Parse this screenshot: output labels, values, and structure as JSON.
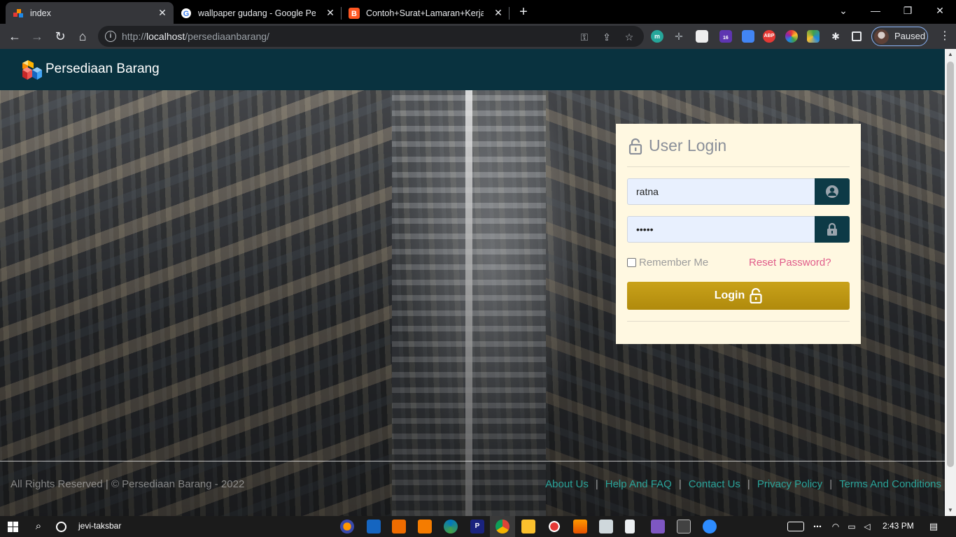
{
  "browser": {
    "tabs": [
      {
        "title": "index",
        "active": true
      },
      {
        "title": "wallpaper gudang - Google Pene",
        "active": false
      },
      {
        "title": "Contoh+Surat+Lamaran+Kerja+",
        "active": false
      }
    ],
    "new_tab": "+",
    "url_prefix": "http://",
    "url_host": "localhost",
    "url_path": "/persediaanbarang/",
    "profile_label": "Paused",
    "extension_badge": "16",
    "abp_label": "ABP",
    "ext_m_label": "m"
  },
  "header": {
    "brand": "Persediaan Barang"
  },
  "login": {
    "title": "User Login",
    "username_value": "ratna",
    "password_value": "•••••",
    "remember_label": "Remember Me",
    "remember_checked": false,
    "reset_label": "Reset Password?",
    "button_label": "Login"
  },
  "footer": {
    "copyright": "All Rights Reserved | © Persediaan Barang - 2022",
    "links": [
      "About Us",
      "Help And FAQ",
      "Contact Us",
      "Privacy Policy",
      "Terms And Conditions"
    ]
  },
  "taskbar": {
    "search_label": "jevi-taksbar",
    "time": "2:43 PM"
  },
  "colors": {
    "header_bg": "#09323f",
    "card_bg": "#fff8e1",
    "addon_bg": "#0d3a46",
    "button_gold": "#b8920f",
    "reset_pink": "#e05c8a",
    "footer_link": "#2aa399"
  }
}
